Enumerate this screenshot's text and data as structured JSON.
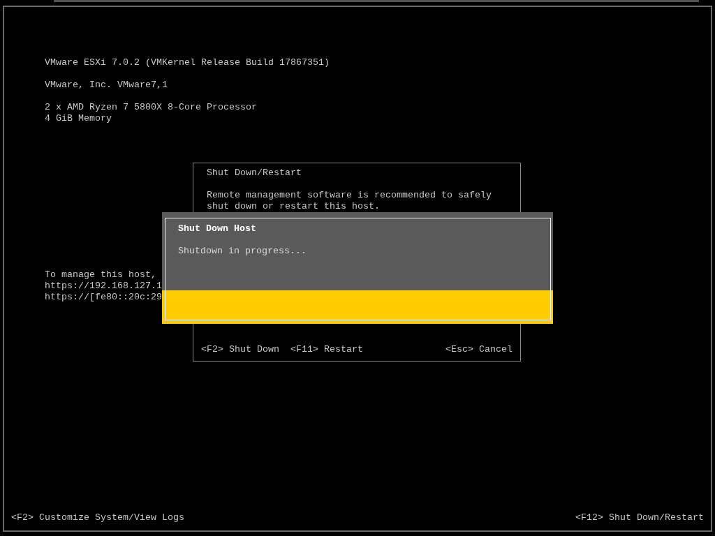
{
  "system_info": {
    "groups": [
      {
        "lines": [
          "VMware ESXi 7.0.2 (VMKernel Release Build 17867351)"
        ]
      },
      {
        "lines": [
          "VMware, Inc. VMware7,1"
        ]
      },
      {
        "lines": [
          "2 x AMD Ryzen 7 5800X 8-Core Processor",
          "4 GiB Memory"
        ]
      }
    ]
  },
  "management_info": {
    "lines": [
      "To manage this host,",
      "https://192.168.127.1",
      "https://[fe80::20c:29"
    ]
  },
  "restart_dialog": {
    "title": "Shut Down/Restart",
    "message": "Remote management software is recommended to safely shut down or restart this host.",
    "actions": [
      {
        "key": "<F2>",
        "label": "Shut Down"
      },
      {
        "key": "<F11>",
        "label": "Restart"
      }
    ],
    "cancel": {
      "key": "<Esc>",
      "label": "Cancel"
    }
  },
  "shutdown_dialog": {
    "title": "Shut Down Host",
    "message": "Shutdown in progress..."
  },
  "footer": {
    "left": "<F2> Customize System/View Logs",
    "right": "<F12> Shut Down/Restart"
  }
}
